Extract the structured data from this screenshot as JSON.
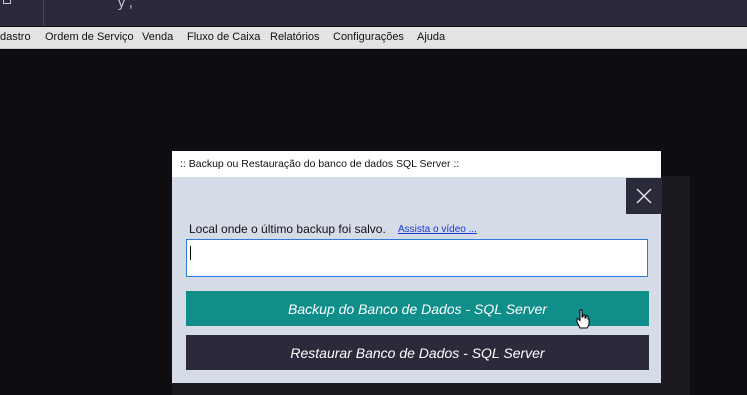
{
  "titlebar": {
    "title_fragment": "y    ,"
  },
  "menu": {
    "items": [
      "dastro",
      "Ordem de Serviço",
      "Venda",
      "Fluxo de Caixa",
      "Relatórios",
      "Configurações",
      "Ajuda"
    ]
  },
  "dialog": {
    "title": ":: Backup ou Restauração do banco de dados SQL Server ::",
    "close_icon": "close-icon",
    "local_label": "Local onde o último backup foi salvo.",
    "video_link": "Assista o vídeo ...",
    "path_value": "",
    "backup_button": "Backup do Banco de Dados - SQL Server",
    "restore_button": "Restaurar Banco de Dados - SQL Server"
  },
  "colors": {
    "backup_button_bg": "#0f8e8a",
    "restore_button_bg": "#2b2a3a",
    "dialog_bg": "#d6dbe8",
    "link_color": "#1a3ad6"
  }
}
